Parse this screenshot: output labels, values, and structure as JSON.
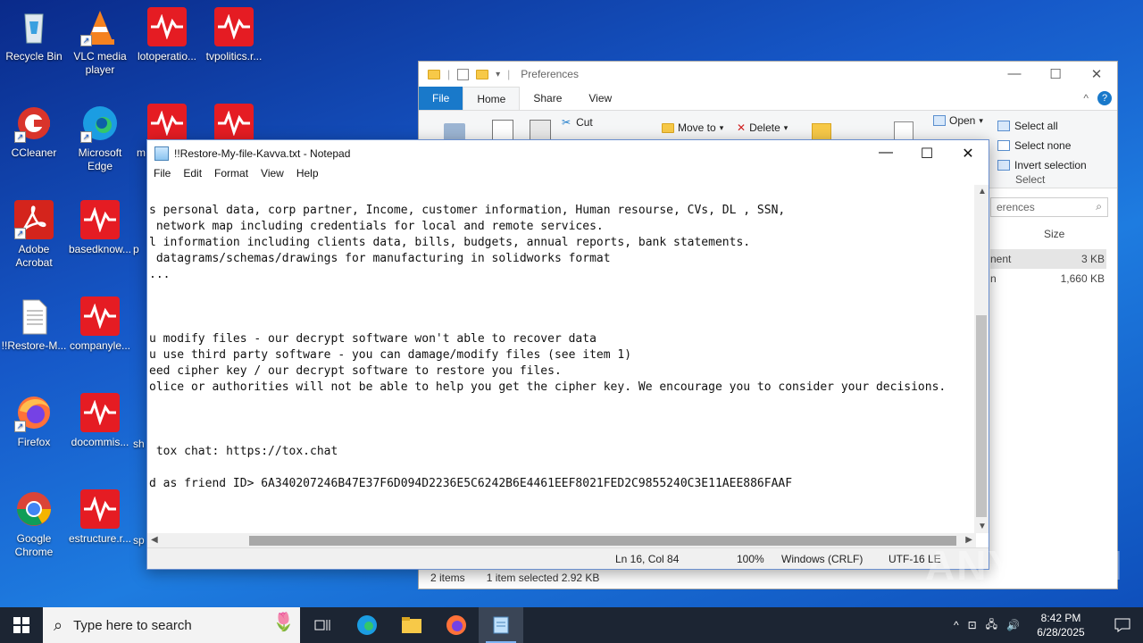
{
  "desktop": {
    "icons": [
      {
        "label": "Recycle Bin",
        "icon": "recycle-bin-icon"
      },
      {
        "label": "VLC media player",
        "icon": "vlc-icon"
      },
      {
        "label": "lotoperatio...",
        "icon": "avast-icon"
      },
      {
        "label": "tvpolitics.r...",
        "icon": "avast-icon"
      },
      {
        "label": "CCleaner",
        "icon": "ccleaner-icon"
      },
      {
        "label": "Microsoft Edge",
        "icon": "edge-icon"
      },
      {
        "label": "m",
        "icon": "avast-icon"
      },
      {
        "label": "Adobe Acrobat",
        "icon": "acrobat-icon"
      },
      {
        "label": "basedknow...",
        "icon": "avast-icon"
      },
      {
        "label": "p",
        "icon": "avast-icon"
      },
      {
        "label": "!!Restore-M...",
        "icon": "text-file-icon"
      },
      {
        "label": "companyle...",
        "icon": "avast-icon"
      },
      {
        "label": "Firefox",
        "icon": "firefox-icon"
      },
      {
        "label": "docommis...",
        "icon": "avast-icon"
      },
      {
        "label": "sh",
        "icon": "avast-icon"
      },
      {
        "label": "Google Chrome",
        "icon": "chrome-icon"
      },
      {
        "label": "estructure.r...",
        "icon": "avast-icon"
      },
      {
        "label": "sp",
        "icon": "avast-icon"
      }
    ]
  },
  "explorer": {
    "title": "Preferences",
    "tabs": [
      "File",
      "Home",
      "Share",
      "View"
    ],
    "ribbon": {
      "cut": "Cut",
      "move_to": "Move to",
      "delete": "Delete",
      "open": "Open",
      "select_all": "Select all",
      "select_none": "Select none",
      "invert_selection": "Invert selection",
      "select_group": "Select"
    },
    "search_placeholder": "erences",
    "column_size": "Size",
    "rows": [
      {
        "name": "nent",
        "size": "3 KB"
      },
      {
        "name": "n",
        "size": "1,660 KB"
      }
    ],
    "status": {
      "items": "2 items",
      "selected": "1 item selected  2.92 KB"
    }
  },
  "notepad": {
    "title": "!!Restore-My-file-Kavva.txt - Notepad",
    "menu": [
      "File",
      "Edit",
      "Format",
      "View",
      "Help"
    ],
    "lines": [
      "s personal data, corp partner, Income, customer information, Human resourse, CVs, DL , SSN,",
      " network map including credentials for local and remote services.",
      "l information including clients data, bills, budgets, annual reports, bank statements.",
      " datagrams/schemas/drawings for manufacturing in solidworks format",
      "...",
      "",
      "",
      "",
      "u modify files - our decrypt software won't able to recover data",
      "u use third party software - you can damage/modify files (see item 1)",
      "eed cipher key / our decrypt software to restore you files.",
      "olice or authorities will not be able to help you get the cipher key. We encourage you to consider your decisions.",
      "",
      "",
      "",
      " tox chat: https://tox.chat",
      "",
      "d as friend ID> 6A340207246B47E37F6D094D2236E5C6242B6E4461EEF8021FED2C9855240C3E11AEE886FAAF"
    ],
    "status": {
      "position": "Ln 16, Col 84",
      "zoom": "100%",
      "line_ending": "Windows (CRLF)",
      "encoding": "UTF-16 LE"
    }
  },
  "taskbar": {
    "search_placeholder": "Type here to search",
    "time": "8:42 PM",
    "date": "6/28/2025"
  },
  "watermark": "ANY RUN"
}
